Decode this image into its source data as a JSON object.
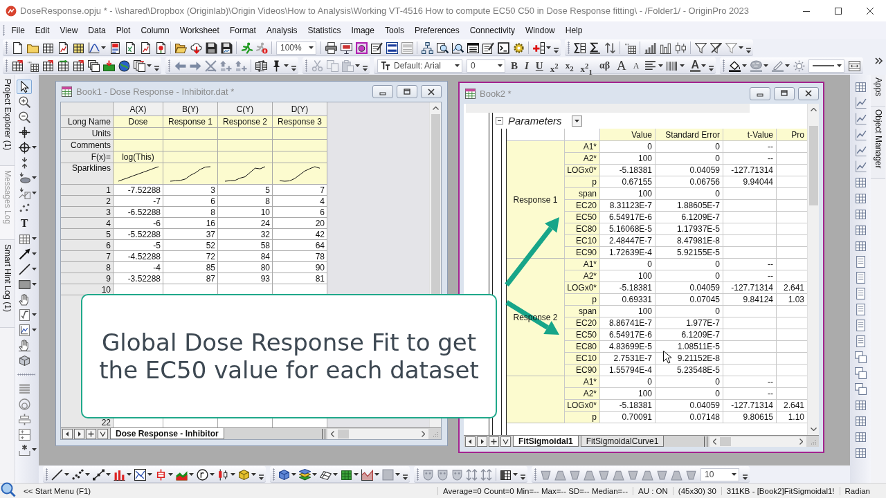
{
  "title_bar": {
    "title": "DoseResponse.opju * - \\\\shared\\Dropbox (Originlab)\\Origin Videos\\How to Analysis\\Working VT-4516 How to compute EC50 C50 in Dose Response fitting\\ - /Folder1/ - OriginPro 2023"
  },
  "menu": [
    "File",
    "Edit",
    "View",
    "Data",
    "Plot",
    "Column",
    "Worksheet",
    "Format",
    "Analysis",
    "Statistics",
    "Image",
    "Tools",
    "Preferences",
    "Connectivity",
    "Window",
    "Help"
  ],
  "toolbar": {
    "zoom": "100%",
    "font": "Default: Arial",
    "font_size": "0",
    "format_buttons": [
      {
        "text": "B",
        "kind": "bold"
      },
      {
        "text": "I",
        "kind": "italic"
      },
      {
        "text": "U",
        "kind": "underline"
      },
      {
        "text": "x$^{2}$",
        "kind": "script"
      },
      {
        "text": "x$_{2}$",
        "kind": "script"
      },
      {
        "text": "x$^{2}$$_{1}$",
        "kind": "script"
      },
      {
        "text": "αβ",
        "kind": "greek"
      },
      {
        "text": "A",
        "kind": "grow"
      },
      {
        "text": "A",
        "kind": "shrink"
      }
    ],
    "font_color": "A"
  },
  "side_tabs": [
    {
      "label": "Project Explorer (1)",
      "disabled": false
    },
    {
      "label": "Messages Log",
      "disabled": true
    },
    {
      "label": "Smart Hint Log (1)",
      "disabled": false
    }
  ],
  "tool_groups": [
    {
      "tools": [
        {
          "selected": true
        },
        {
          "selected": false
        },
        {
          "selected": false
        },
        {
          "selected": false
        },
        {
          "selected": false
        },
        {
          "selected": false
        },
        {
          "selected": false
        },
        {
          "selected": false
        },
        {
          "selected": false
        },
        {
          "label": "T",
          "selected": false
        },
        {
          "selected": false
        },
        {
          "selected": false
        },
        {
          "selected": false
        },
        {
          "selected": false
        },
        {
          "selected": false
        },
        {
          "selected": false
        },
        {
          "selected": false
        },
        {
          "selected": false
        },
        {
          "selected": false
        }
      ]
    },
    {
      "tools": [
        {
          "selected": false
        },
        {
          "selected": false
        },
        {
          "selected": false
        },
        {
          "selected": false
        },
        {
          "selected": false
        }
      ]
    }
  ],
  "book1": {
    "title": "Book1 - Dose Response - Inhibitor.dat *",
    "active": false,
    "columns": [
      "A(X)",
      "B(Y)",
      "C(Y)",
      "D(Y)"
    ],
    "label_rows": [
      {
        "label": "Long Name",
        "kind": "text",
        "cells": [
          "Dose",
          "Response 1",
          "Response 2",
          "Response 3"
        ]
      },
      {
        "label": "Units",
        "kind": "text"
      },
      {
        "label": "Comments",
        "kind": "text"
      },
      {
        "label": "F(x)=",
        "kind": "text",
        "cells": [
          "log(This)"
        ]
      },
      {
        "label": "Sparklines",
        "kind": "sparklines"
      }
    ],
    "rows": [
      [
        "1",
        "-7.52288",
        "3",
        "5",
        "7"
      ],
      [
        "2",
        "-7",
        "6",
        "8",
        "4"
      ],
      [
        "3",
        "-6.52288",
        "8",
        "10",
        "6"
      ],
      [
        "4",
        "-6",
        "16",
        "24",
        "20"
      ],
      [
        "5",
        "-5.52288",
        "37",
        "32",
        "42"
      ],
      [
        "6",
        "-5",
        "52",
        "58",
        "64"
      ],
      [
        "7",
        "-4.52288",
        "72",
        "84",
        "78"
      ],
      [
        "8",
        "-4",
        "85",
        "80",
        "90"
      ],
      [
        "9",
        "-3.52288",
        "87",
        "93",
        "81"
      ]
    ],
    "blank_rows": [
      "10",
      "22"
    ],
    "sheet_tabs": [
      {
        "label": "Dose Response - Inhibitor",
        "selected": true
      }
    ]
  },
  "book2": {
    "title": "Book2 *",
    "active": true,
    "section": "Parameters",
    "columns": [
      "Value",
      "Standard Error",
      "t-Value",
      "Pro"
    ],
    "groups": [
      {
        "label": "Response 1",
        "rows": [
          {
            "name": "A1*",
            "cells": [
              "0",
              "0",
              "--"
            ]
          },
          {
            "name": "A2*",
            "cells": [
              "100",
              "0",
              "--"
            ]
          },
          {
            "name": "LOGx0*",
            "cells": [
              "-5.18381",
              "0.04059",
              "-127.71314"
            ]
          },
          {
            "name": "p",
            "cells": [
              "0.67155",
              "0.06756",
              "9.94044"
            ]
          },
          {
            "name": "span",
            "cells": [
              "100",
              "0"
            ]
          },
          {
            "name": "EC20",
            "cells": [
              "8.31123E-7",
              "1.88605E-7"
            ]
          },
          {
            "name": "EC50",
            "cells": [
              "6.54917E-6",
              "6.1209E-7"
            ]
          },
          {
            "name": "EC80",
            "cells": [
              "5.16068E-5",
              "1.17937E-5"
            ]
          },
          {
            "name": "EC10",
            "cells": [
              "2.48447E-7",
              "8.47981E-8"
            ]
          },
          {
            "name": "EC90",
            "cells": [
              "1.72639E-4",
              "5.92155E-5"
            ]
          }
        ]
      },
      {
        "label": "Response 2",
        "rows": [
          {
            "name": "A1*",
            "cells": [
              "0",
              "0",
              "--"
            ]
          },
          {
            "name": "A2*",
            "cells": [
              "100",
              "0",
              "--"
            ]
          },
          {
            "name": "LOGx0*",
            "cells": [
              "-5.18381",
              "0.04059",
              "-127.71314",
              "2.641"
            ]
          },
          {
            "name": "p",
            "cells": [
              "0.69331",
              "0.07045",
              "9.84124",
              "1.03"
            ]
          },
          {
            "name": "span",
            "cells": [
              "100",
              "0"
            ]
          },
          {
            "name": "EC20",
            "cells": [
              "8.86741E-7",
              "1.977E-7"
            ]
          },
          {
            "name": "EC50",
            "cells": [
              "6.54917E-6",
              "6.1209E-7"
            ]
          },
          {
            "name": "EC80",
            "cells": [
              "4.83699E-5",
              "1.08511E-5"
            ]
          },
          {
            "name": "EC10",
            "cells": [
              "2.7531E-7",
              "9.21152E-8"
            ]
          },
          {
            "name": "EC90",
            "cells": [
              "1.55794E-4",
              "5.23548E-5"
            ]
          }
        ]
      },
      {
        "rows": [
          {
            "name": "A1*",
            "cells": [
              "0",
              "0",
              "--"
            ]
          },
          {
            "name": "A2*",
            "cells": [
              "100",
              "0",
              "--"
            ]
          },
          {
            "name": "LOGx0*",
            "cells": [
              "-5.18381",
              "0.04059",
              "-127.71314",
              "2.641"
            ]
          },
          {
            "name": "p",
            "cells": [
              "0.70091",
              "0.07148",
              "9.80615",
              "1.10"
            ]
          }
        ]
      }
    ],
    "sheet_tabs": [
      {
        "label": "FitSigmoidal1",
        "selected": true
      },
      {
        "label": "FitSigmoidalCurve1",
        "selected": false
      }
    ]
  },
  "callout": "Global Dose Response Fit to get the EC50 value for each dataset",
  "right_tabs": [
    "Apps",
    "Object Manager"
  ],
  "bottom_toolbar": {
    "size": "10"
  },
  "status_bar": [
    "<< Start Menu (F1)",
    "Average=0 Count=0 Min=-- Max=-- SD=-- Median=--",
    "AU : ON",
    "(45x30) 30",
    "311KB - [Book2]FitSigmoidal1!",
    "Radian"
  ]
}
